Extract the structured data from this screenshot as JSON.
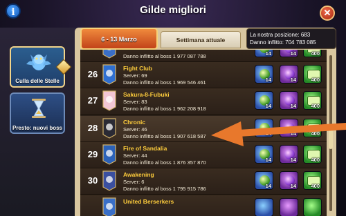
{
  "header": {
    "title": "Gilde migliori"
  },
  "left_cards": [
    {
      "label": "Culla delle Stelle"
    },
    {
      "label": "Presto: nuovi boss"
    }
  ],
  "tabs": {
    "active": "6 - 13 Marzo",
    "inactive": "Settimana attuale"
  },
  "my_position": {
    "position_line": "La nostra posizione: 683",
    "damage_line": "Danno inflitto: 704 783 085"
  },
  "rows": [
    {
      "rank": "",
      "name": "",
      "server": "",
      "damage": "Danno inflitto al boss 1 977 087 788",
      "banner_color": "#3a6fc7",
      "r1": "14",
      "r2": "14",
      "r3": "400"
    },
    {
      "rank": "26",
      "name": "Fight Club",
      "server": "Server: 69",
      "damage": "Danno inflitto al boss 1 969 546 461",
      "banner_color": "#2f6fd0",
      "r1": "14",
      "r2": "14",
      "r3": "400"
    },
    {
      "rank": "27",
      "name": "Sakura-8-Fubuki",
      "server": "Server: 83",
      "damage": "Danno inflitto al boss 1 962 208 918",
      "banner_color": "#f2c6d4",
      "r1": "14",
      "r2": "14",
      "r3": "400"
    },
    {
      "rank": "28",
      "name": "Chronic",
      "server": "Server: 46",
      "damage": "Danno inflitto al boss 1 907 618 587",
      "banner_color": "#2a2a34",
      "r1": "14",
      "r2": "14",
      "r3": "400"
    },
    {
      "rank": "29",
      "name": "Fire of Sandalia",
      "server": "Server: 44",
      "damage": "Danno inflitto al boss 1 876 357 870",
      "banner_color": "#2c62b8",
      "r1": "14",
      "r2": "14",
      "r3": "400"
    },
    {
      "rank": "30",
      "name": "Awakening",
      "server": "Server: 6",
      "damage": "Danno inflitto al boss 1 795 915 786",
      "banner_color": "#3a4fa0",
      "r1": "14",
      "r2": "14",
      "r3": "400"
    },
    {
      "rank": "",
      "name": "United Berserkers",
      "server": "",
      "damage": "",
      "banner_color": "#3a6fc7",
      "r1": "",
      "r2": "",
      "r3": ""
    }
  ],
  "colors": {
    "arrow": "#e8782c",
    "gold_text": "#ffce3c"
  },
  "icons": {
    "info": "info-icon",
    "close": "close-icon",
    "reward_1": "blue-orb-icon",
    "reward_2": "purple-orb-icon",
    "reward_3": "green-chest-icon"
  }
}
